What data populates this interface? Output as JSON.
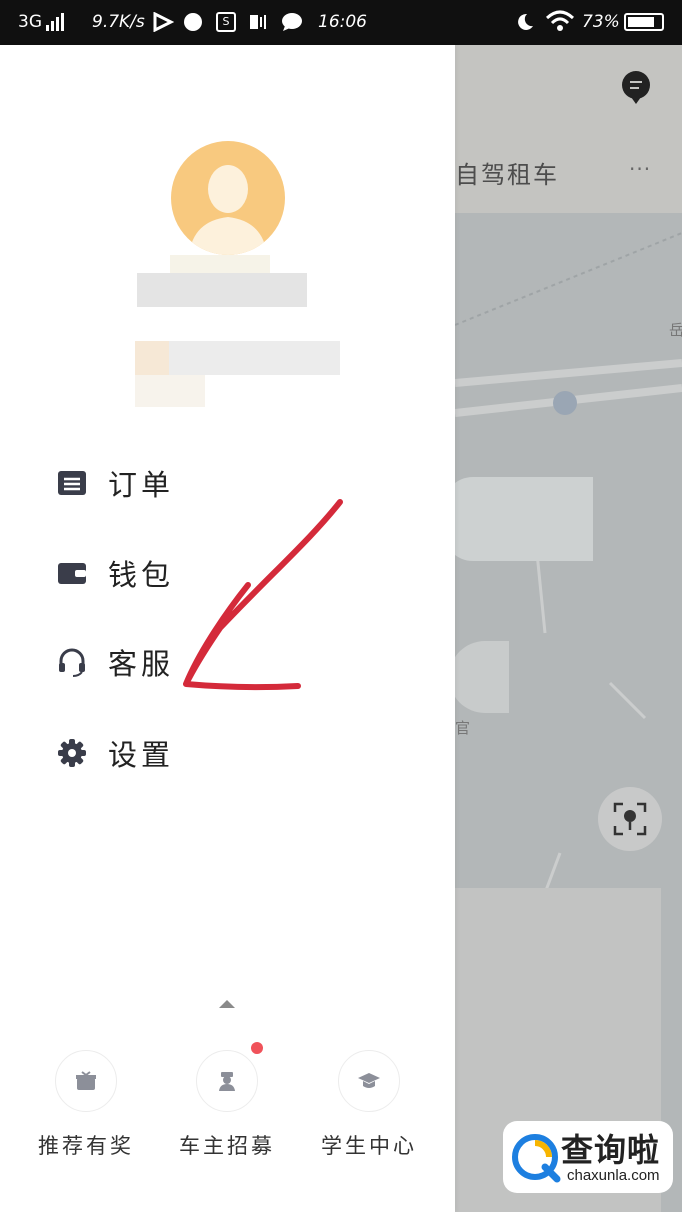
{
  "status_bar": {
    "network": "3G",
    "speed": "9.7K/s",
    "time": "16:06",
    "battery": "73%"
  },
  "map": {
    "title": "自驾租车",
    "more": "···",
    "label_small": "岳",
    "label_guan": "官"
  },
  "drawer": {
    "menu": [
      {
        "label": "订单",
        "icon": "order-list-icon"
      },
      {
        "label": "钱包",
        "icon": "wallet-icon"
      },
      {
        "label": "客服",
        "icon": "headset-icon"
      },
      {
        "label": "设置",
        "icon": "gear-icon"
      }
    ],
    "bottom": [
      {
        "label": "推荐有奖",
        "icon": "gift-icon"
      },
      {
        "label": "车主招募",
        "icon": "driver-icon"
      },
      {
        "label": "学生中心",
        "icon": "graduation-cap-icon"
      }
    ]
  },
  "watermark": {
    "title": "查询啦",
    "sub": "chaxunla.com"
  },
  "colors": {
    "avatar": "#f8c97f",
    "annotation_arrow": "#d42a3a",
    "badge": "#f0525a"
  }
}
